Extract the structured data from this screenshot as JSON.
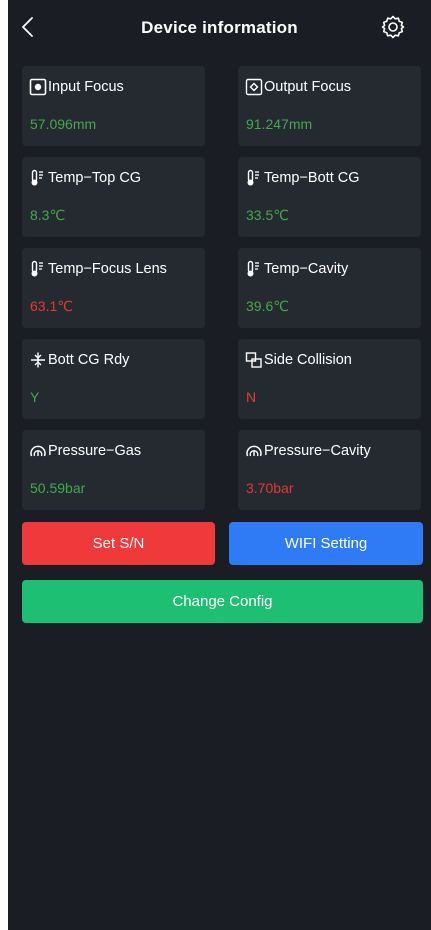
{
  "header": {
    "title": "Device information"
  },
  "cards": [
    {
      "label": "Input Focus",
      "value": "57.096mm",
      "icon": "input-focus-icon",
      "color": "#45a84a"
    },
    {
      "label": "Output Focus",
      "value": "91.247mm",
      "icon": "output-focus-icon",
      "color": "#45a84a"
    },
    {
      "label": "Temp−Top CG",
      "value": "8.3℃",
      "icon": "thermometer-icon",
      "color": "#45a84a"
    },
    {
      "label": "Temp−Bott CG",
      "value": "33.5℃",
      "icon": "thermometer-icon",
      "color": "#45a84a"
    },
    {
      "label": "Temp−Focus Lens",
      "value": "63.1℃",
      "icon": "thermometer-icon",
      "color": "#e53935"
    },
    {
      "label": "Temp−Cavity",
      "value": "39.6℃",
      "icon": "thermometer-icon",
      "color": "#45a84a"
    },
    {
      "label": "Bott CG Rdy",
      "value": "Y",
      "icon": "distance-icon",
      "color": "#45a84a"
    },
    {
      "label": "Side Collision",
      "value": "N",
      "icon": "collision-icon",
      "color": "#e53935"
    },
    {
      "label": "Pressure−Gas",
      "value": "50.59bar",
      "icon": "gauge-icon",
      "color": "#45a84a"
    },
    {
      "label": "Pressure−Cavity",
      "value": "3.70bar",
      "icon": "gauge-icon",
      "color": "#e53935"
    }
  ],
  "buttons": {
    "set_sn": "Set S/N",
    "wifi": "WIFI Setting",
    "change_config": "Change Config"
  },
  "colors": {
    "background": "#1a1e24",
    "card": "#252a31",
    "good": "#45a84a",
    "alarm": "#e53935",
    "set_sn_button": "#f0393b",
    "wifi_button": "#2f7bf5",
    "change_config_button": "#1dbf73"
  }
}
